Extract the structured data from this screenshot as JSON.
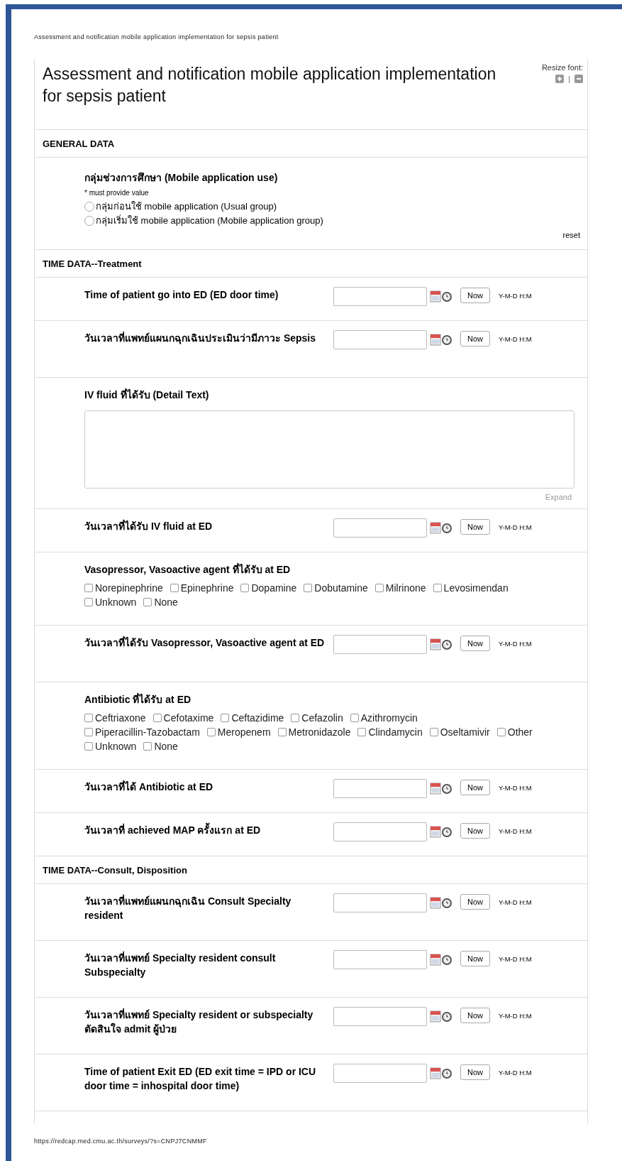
{
  "print_header": "Assessment and notification mobile application implementation for sepsis patient",
  "survey_title": "Assessment and notification mobile application implementation for sepsis patient",
  "resize_font": {
    "label": "Resize font:",
    "separator": "|"
  },
  "sections": [
    {
      "title": "GENERAL DATA",
      "fields": [
        {
          "kind": "radio",
          "label": "กลุ่มช่วงการศึกษา (Mobile application use)",
          "required_note": "* must provide value",
          "reset": "reset",
          "options": [
            {
              "label": "กลุ่มก่อนใช้ mobile application (Usual group)",
              "selected": false
            },
            {
              "label": "กลุ่มเริ่มใช้ mobile application (Mobile application group)",
              "selected": false
            }
          ]
        }
      ]
    },
    {
      "title": "TIME DATA--Treatment",
      "fields": [
        {
          "kind": "datetime",
          "label": "Time of patient go into ED (ED door time)",
          "button": "Now",
          "format": "Y-M-D H:M"
        },
        {
          "kind": "datetime",
          "label": "วันเวลาที่แพทย์แผนกฉุกเฉินประเมินว่ามีภาวะ Sepsis",
          "button": "Now",
          "format": "Y-M-D H:M"
        },
        {
          "kind": "textarea",
          "label": "IV fluid ที่ได้รับ (Detail Text)",
          "expand": "Expand"
        },
        {
          "kind": "datetime",
          "label": "วันเวลาที่ได้รับ IV fluid at ED",
          "button": "Now",
          "format": "Y-M-D H:M"
        },
        {
          "kind": "checkbox",
          "label": "Vasopressor, Vasoactive agent ที่ได้รับ at ED",
          "options": [
            {
              "label": "Norepinephrine",
              "checked": false
            },
            {
              "label": "Epinephrine",
              "checked": false
            },
            {
              "label": "Dopamine",
              "checked": false
            },
            {
              "label": "Dobutamine",
              "checked": false
            },
            {
              "label": "Milrinone",
              "checked": false
            },
            {
              "label": "Levosimendan",
              "checked": false
            },
            {
              "label": "Unknown",
              "checked": false
            },
            {
              "label": "None",
              "checked": false
            }
          ]
        },
        {
          "kind": "datetime",
          "label": "วันเวลาที่ได้รับ Vasopressor, Vasoactive agent at ED",
          "button": "Now",
          "format": "Y-M-D H:M"
        },
        {
          "kind": "checkbox",
          "label": "Antibiotic ที่ได้รับ at ED",
          "options": [
            {
              "label": "Ceftriaxone",
              "checked": false
            },
            {
              "label": "Cefotaxime",
              "checked": false
            },
            {
              "label": "Ceftazidime",
              "checked": false
            },
            {
              "label": "Cefazolin",
              "checked": false
            },
            {
              "label": "Azithromycin",
              "checked": false
            },
            {
              "label": "Piperacillin-Tazobactam",
              "checked": false
            },
            {
              "label": "Meropenem",
              "checked": false
            },
            {
              "label": "Metronidazole",
              "checked": false
            },
            {
              "label": "Clindamycin",
              "checked": false
            },
            {
              "label": "Oseltamivir",
              "checked": false
            },
            {
              "label": "Other",
              "checked": false
            },
            {
              "label": "Unknown",
              "checked": false
            },
            {
              "label": "None",
              "checked": false
            }
          ]
        },
        {
          "kind": "datetime",
          "label": "วันเวลาที่ได้ Antibiotic at ED",
          "button": "Now",
          "format": "Y-M-D H:M"
        },
        {
          "kind": "datetime",
          "label": "วันเวลาที่ achieved MAP ครั้งแรก at ED",
          "button": "Now",
          "format": "Y-M-D H:M"
        }
      ]
    },
    {
      "title": "TIME DATA--Consult, Disposition",
      "fields": [
        {
          "kind": "datetime",
          "label": "วันเวลาที่แพทย์แผนกฉุกเฉิน Consult Specialty resident",
          "button": "Now",
          "format": "Y-M-D H:M"
        },
        {
          "kind": "datetime",
          "label": "วันเวลาที่แพทย์ Specialty resident consult Subspecialty",
          "button": "Now",
          "format": "Y-M-D H:M"
        },
        {
          "kind": "datetime",
          "label": "วันเวลาที่แพทย์ Specialty resident or subspecialty ตัดสินใจ admit ผู้ป่วย",
          "button": "Now",
          "format": "Y-M-D H:M"
        },
        {
          "kind": "datetime",
          "label": "Time of patient Exit ED (ED exit time = IPD or ICU door time = inhospital door time)",
          "button": "Now",
          "format": "Y-M-D H:M"
        }
      ]
    }
  ],
  "print_footer": "https://redcap.med.cmu.ac.th/surveys/?s=CNPJ7CNMMF"
}
